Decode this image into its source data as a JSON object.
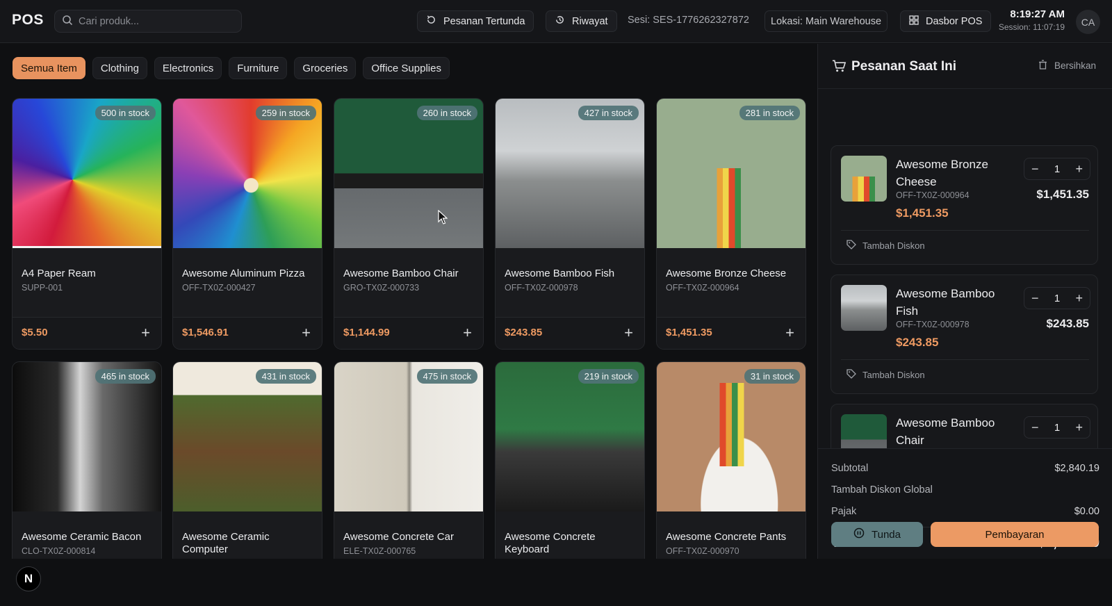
{
  "header": {
    "brand": "POS",
    "search_placeholder": "Cari produk...",
    "pending_label": "Pesanan Tertunda",
    "history_label": "Riwayat",
    "session_id": "Sesi: SES-1776262327872",
    "location": "Lokasi: Main Warehouse",
    "dashboard_label": "Dasbor POS",
    "time": "8:19:27 AM",
    "session_timer": "Session: 11:07:19",
    "avatar": "CA"
  },
  "categories": [
    {
      "label": "Semua Item",
      "active": true
    },
    {
      "label": "Clothing"
    },
    {
      "label": "Electronics"
    },
    {
      "label": "Furniture"
    },
    {
      "label": "Groceries"
    },
    {
      "label": "Office Supplies"
    }
  ],
  "products": [
    {
      "name": "A4 Paper Ream",
      "sku": "SUPP-001",
      "price": "$5.50",
      "stock": "500 in stock"
    },
    {
      "name": "Awesome Aluminum Pizza",
      "sku": "OFF-TX0Z-000427",
      "price": "$1,546.91",
      "stock": "259 in stock"
    },
    {
      "name": "Awesome Bamboo Chair",
      "sku": "GRO-TX0Z-000733",
      "price": "$1,144.99",
      "stock": "260 in stock"
    },
    {
      "name": "Awesome Bamboo Fish",
      "sku": "OFF-TX0Z-000978",
      "price": "$243.85",
      "stock": "427 in stock"
    },
    {
      "name": "Awesome Bronze Cheese",
      "sku": "OFF-TX0Z-000964",
      "price": "$1,451.35",
      "stock": "281 in stock"
    },
    {
      "name": "Awesome Ceramic Bacon",
      "sku": "CLO-TX0Z-000814",
      "price": "",
      "stock": "465 in stock"
    },
    {
      "name": "Awesome Ceramic Computer",
      "sku": "",
      "price": "",
      "stock": "431 in stock"
    },
    {
      "name": "Awesome Concrete Car",
      "sku": "ELE-TX0Z-000765",
      "price": "",
      "stock": "475 in stock"
    },
    {
      "name": "Awesome Concrete Keyboard",
      "sku": "",
      "price": "",
      "stock": "219 in stock"
    },
    {
      "name": "Awesome Concrete Pants",
      "sku": "OFF-TX0Z-000970",
      "price": "",
      "stock": "31 in stock"
    }
  ],
  "order": {
    "title": "Pesanan Saat Ini",
    "clear_label": "Bersihkan",
    "discount_label": "Tambah Diskon",
    "items": [
      {
        "name": "Awesome Bronze Cheese",
        "sku": "OFF-TX0Z-000964",
        "price": "$1,451.35",
        "qty": "1",
        "total": "$1,451.35"
      },
      {
        "name": "Awesome Bamboo Fish",
        "sku": "OFF-TX0Z-000978",
        "price": "$243.85",
        "qty": "1",
        "total": "$243.85"
      },
      {
        "name": "Awesome Bamboo Chair",
        "sku": "",
        "price": "",
        "qty": "1",
        "total": ""
      }
    ],
    "subtotal_label": "Subtotal",
    "subtotal": "$2,840.19",
    "global_discount_label": "Tambah Diskon Global",
    "tax_label": "Pajak",
    "tax": "$0.00",
    "total_label": "Total",
    "total": "$2,840.19",
    "hold_label": "Tunda",
    "pay_label": "Pembayaran"
  },
  "footer": {
    "badge": "N"
  }
}
